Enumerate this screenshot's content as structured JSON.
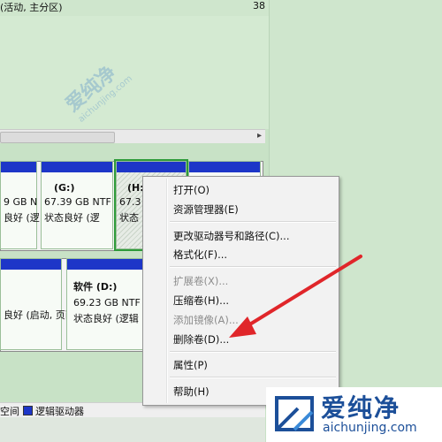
{
  "top_row": {
    "text": "(活动, 主分区)",
    "value": "38"
  },
  "disk1": {
    "partitions": [
      {
        "line1": "9 GB N",
        "line2": "良好 (逻"
      },
      {
        "name": "(G:)",
        "size": "67.39 GB NTF",
        "status": "状态良好 (逻"
      },
      {
        "name": "(H:",
        "size": "67.3",
        "status": "状态"
      }
    ]
  },
  "disk2": {
    "partitions": [
      {
        "line1": "良好 (启动, 页面文件,"
      },
      {
        "name": "软件  (D:)",
        "size": "69.23 GB NTF",
        "status": "状态良好 (逻辑"
      }
    ]
  },
  "legend": {
    "left_text": "空间",
    "item": "逻辑驱动器",
    "item_color": "#1d36c8"
  },
  "context_menu": {
    "items": [
      {
        "label": "打开(O)",
        "enabled": true
      },
      {
        "label": "资源管理器(E)",
        "enabled": true
      },
      {
        "label": "更改驱动器号和路径(C)...",
        "enabled": true
      },
      {
        "label": "格式化(F)...",
        "enabled": true
      },
      {
        "label": "扩展卷(X)...",
        "enabled": false
      },
      {
        "label": "压缩卷(H)...",
        "enabled": true
      },
      {
        "label": "添加镜像(A)...",
        "enabled": false
      },
      {
        "label": "删除卷(D)...",
        "enabled": true
      },
      {
        "label": "属性(P)",
        "enabled": true
      },
      {
        "label": "帮助(H)",
        "enabled": true
      }
    ]
  },
  "watermark": {
    "text": "爱纯净",
    "url": "aichunjing.com"
  },
  "arrow_color": "#e0262a"
}
